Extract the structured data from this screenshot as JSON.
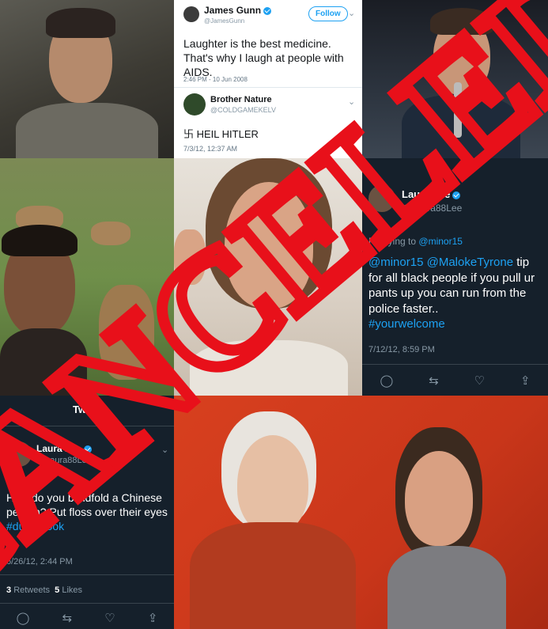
{
  "tweet_gunn": {
    "name": "James Gunn",
    "handle": "@JamesGunn",
    "follow_label": "Follow",
    "text": "Laughter is the best medicine.  That's why I laugh at people with AIDS.",
    "timestamp": "2:46 PM - 10 Jun 2008"
  },
  "tweet_nature": {
    "name": "Brother Nature",
    "handle": "@COLDGAMEKELV",
    "text": "卐 HEIL HITLER",
    "timestamp": "7/3/12, 12:37 AM"
  },
  "tweet_laura_1": {
    "name": "Laura Lee",
    "handle": "@Laura88Lee",
    "reply_prefix": "Replying to",
    "reply_to": "@minor15",
    "mention_1": "@minor15",
    "mention_2": "@MalokeTyrone",
    "text": " tip for all black people if you pull ur pants up you can run from the police faster..",
    "hashtag": "#yourwelcome",
    "timestamp": "7/12/12, 8:59 PM"
  },
  "tweet_laura_2": {
    "header": "Tweet",
    "name": "Laura Lee",
    "handle": "@Laura88Lee",
    "text": "How do you blindfold a Chinese person? Put floss over their eyes",
    "hashtag": "#dumbgook",
    "timestamp": "6/26/12, 2:44 PM",
    "retweets_count": "3",
    "retweets_label": "Retweets",
    "likes_count": "5",
    "likes_label": "Likes"
  },
  "stamp": {
    "text": "CANCELED",
    "color": "#e8101a"
  },
  "icons": [
    "reply-icon",
    "retweet-icon",
    "like-icon",
    "share-icon",
    "verified-icon",
    "chevron-down-icon"
  ]
}
